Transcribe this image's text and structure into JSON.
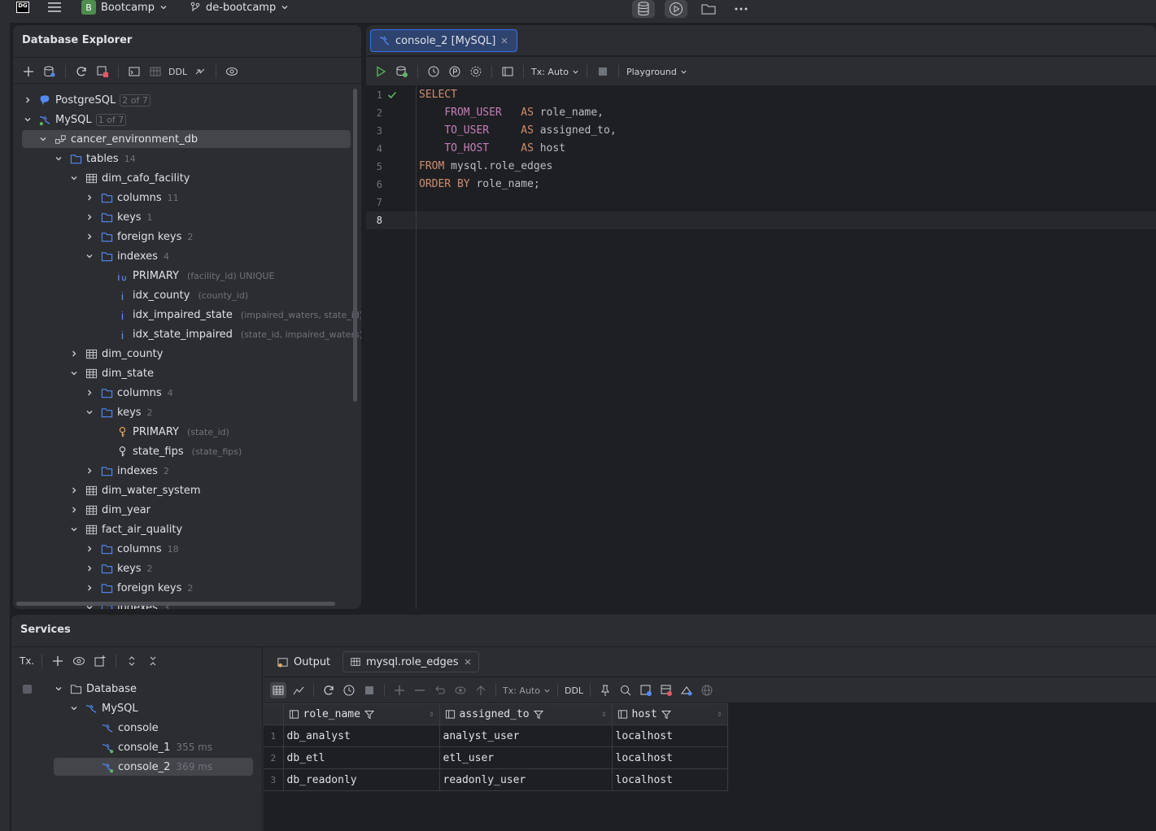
{
  "titlebar": {
    "logo": "DG",
    "project_badge": "B",
    "project": "Bootcamp",
    "branch": "de-bootcamp"
  },
  "db_explorer": {
    "title": "Database Explorer",
    "ddl_label": "DDL",
    "tree": [
      {
        "label": "PostgreSQL",
        "badge": "2 of 7"
      },
      {
        "label": "MySQL",
        "badge": "1 of 7"
      },
      {
        "label": "cancer_environment_db"
      },
      {
        "label": "tables",
        "count": "14"
      },
      {
        "label": "dim_cafo_facility"
      },
      {
        "label": "columns",
        "count": "11"
      },
      {
        "label": "keys",
        "count": "1"
      },
      {
        "label": "foreign keys",
        "count": "2"
      },
      {
        "label": "indexes",
        "count": "4"
      },
      {
        "label": "PRIMARY",
        "detail": "(facility_id) UNIQUE"
      },
      {
        "label": "idx_county",
        "detail": "(county_id)"
      },
      {
        "label": "idx_impaired_state",
        "detail": "(impaired_waters, state_id)"
      },
      {
        "label": "idx_state_impaired",
        "detail": "(state_id, impaired_waters)"
      },
      {
        "label": "dim_county"
      },
      {
        "label": "dim_state"
      },
      {
        "label": "columns",
        "count": "4"
      },
      {
        "label": "keys",
        "count": "2"
      },
      {
        "label": "PRIMARY",
        "detail": "(state_id)"
      },
      {
        "label": "state_fips",
        "detail": "(state_fips)"
      },
      {
        "label": "indexes",
        "count": "2"
      },
      {
        "label": "dim_water_system"
      },
      {
        "label": "dim_year"
      },
      {
        "label": "fact_air_quality"
      },
      {
        "label": "columns",
        "count": "18"
      },
      {
        "label": "keys",
        "count": "2"
      },
      {
        "label": "foreign keys",
        "count": "2"
      },
      {
        "label": "indexes",
        "count": "3"
      }
    ]
  },
  "editor": {
    "tab_label": "console_2 [MySQL]",
    "tx_label": "Tx: Auto",
    "playground_label": "Playground",
    "line_numbers": [
      "1",
      "2",
      "3",
      "4",
      "5",
      "6",
      "7",
      "8"
    ],
    "code": {
      "l1_kw": "SELECT",
      "l2_col": "FROM_USER",
      "l2_as": "AS",
      "l2_rest": " role_name,",
      "l3_col": "TO_USER",
      "l3_as": "AS",
      "l3_rest": " assigned_to,",
      "l4_col": "TO_HOST",
      "l4_as": "AS",
      "l4_rest": " host",
      "l5_kw": "FROM",
      "l5_rest": " mysql.role_edges",
      "l6_kw": "ORDER BY",
      "l6_rest": " role_name;"
    }
  },
  "services": {
    "title": "Services",
    "tx_label": "Tx.",
    "tree": {
      "database": "Database",
      "mysql": "MySQL",
      "consoles": [
        {
          "label": "console",
          "time": ""
        },
        {
          "label": "console_1",
          "time": "355 ms"
        },
        {
          "label": "console_2",
          "time": "369 ms"
        }
      ]
    },
    "tabs": {
      "output": "Output",
      "result": "mysql.role_edges"
    },
    "results_toolbar": {
      "tx_label": "Tx: Auto",
      "ddl_label": "DDL"
    },
    "table": {
      "headers": [
        "role_name",
        "assigned_to",
        "host"
      ],
      "rows": [
        {
          "n": "1",
          "cells": [
            "db_analyst",
            "analyst_user",
            "localhost"
          ]
        },
        {
          "n": "2",
          "cells": [
            "db_etl",
            "etl_user",
            "localhost"
          ]
        },
        {
          "n": "3",
          "cells": [
            "db_readonly",
            "readonly_user",
            "localhost"
          ]
        }
      ]
    }
  },
  "colors": {
    "background": "#1e1f22",
    "panel": "#2b2d30",
    "accent": "#3574f0",
    "keyword": "#cf8e6d",
    "column": "#c77dbb",
    "folder": "#548af7",
    "success": "#5fb865"
  }
}
